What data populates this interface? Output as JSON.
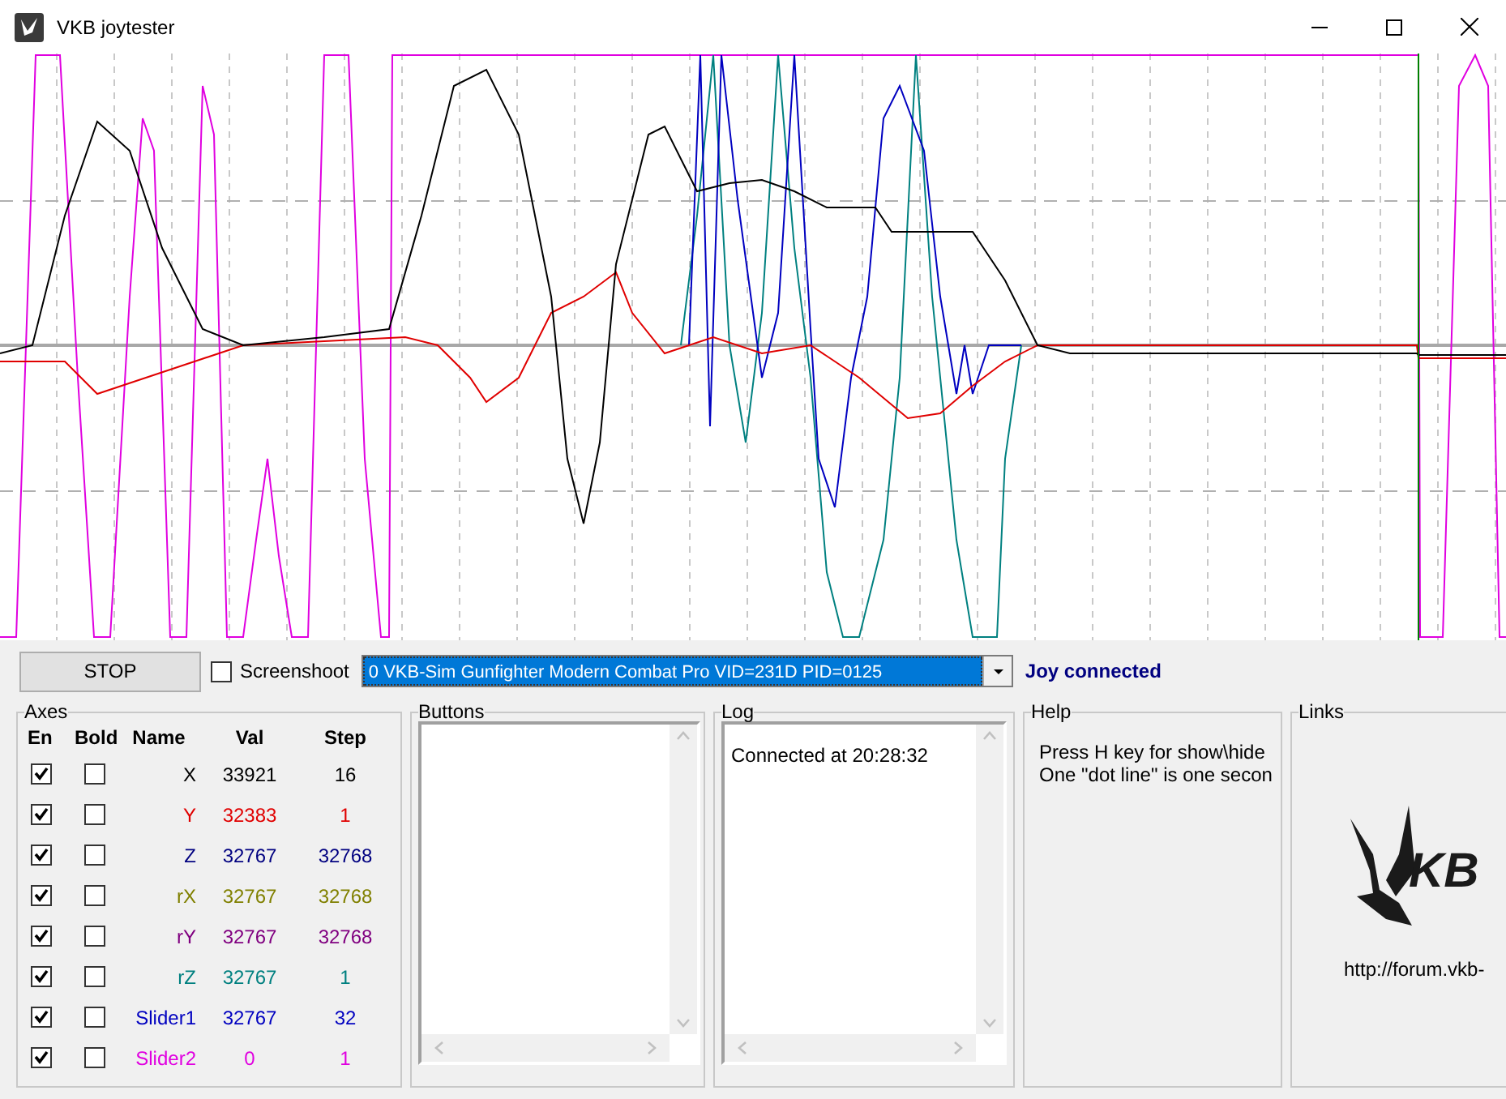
{
  "window": {
    "title": "VKB joytester"
  },
  "toolbar": {
    "stop_label": "STOP",
    "screenshot": {
      "label": "Screenshoot",
      "checked": false
    },
    "device": {
      "value": "0  VKB-Sim Gunfighter Modern Combat Pro  VID=231D PID=0125"
    },
    "status": "Joy connected"
  },
  "axes": {
    "title": "Axes",
    "columns": [
      "En",
      "Bold",
      "Name",
      "Val",
      "Step"
    ],
    "rows": [
      {
        "enabled": true,
        "bold": false,
        "name": "X",
        "val": "33921",
        "step": "16",
        "color": "#000000"
      },
      {
        "enabled": true,
        "bold": false,
        "name": "Y",
        "val": "32383",
        "step": "1",
        "color": "#e00000"
      },
      {
        "enabled": true,
        "bold": false,
        "name": "Z",
        "val": "32767",
        "step": "32768",
        "color": "#000080"
      },
      {
        "enabled": true,
        "bold": false,
        "name": "rX",
        "val": "32767",
        "step": "32768",
        "color": "#808000"
      },
      {
        "enabled": true,
        "bold": false,
        "name": "rY",
        "val": "32767",
        "step": "32768",
        "color": "#800080"
      },
      {
        "enabled": true,
        "bold": false,
        "name": "rZ",
        "val": "32767",
        "step": "1",
        "color": "#008080"
      },
      {
        "enabled": true,
        "bold": false,
        "name": "Slider1",
        "val": "32767",
        "step": "32",
        "color": "#0000c0"
      },
      {
        "enabled": true,
        "bold": false,
        "name": "Slider2",
        "val": "0",
        "step": "1",
        "color": "#e000e0"
      }
    ]
  },
  "buttons": {
    "title": "Buttons"
  },
  "log": {
    "title": "Log",
    "lines": [
      "Connected at 20:28:32"
    ]
  },
  "help": {
    "title": "Help",
    "lines": [
      "Press H key for show\\hide",
      "One \"dot line\" is one secon"
    ]
  },
  "links": {
    "title": "Links",
    "logo_text": "KB",
    "url": "http://forum.vkb-"
  }
}
